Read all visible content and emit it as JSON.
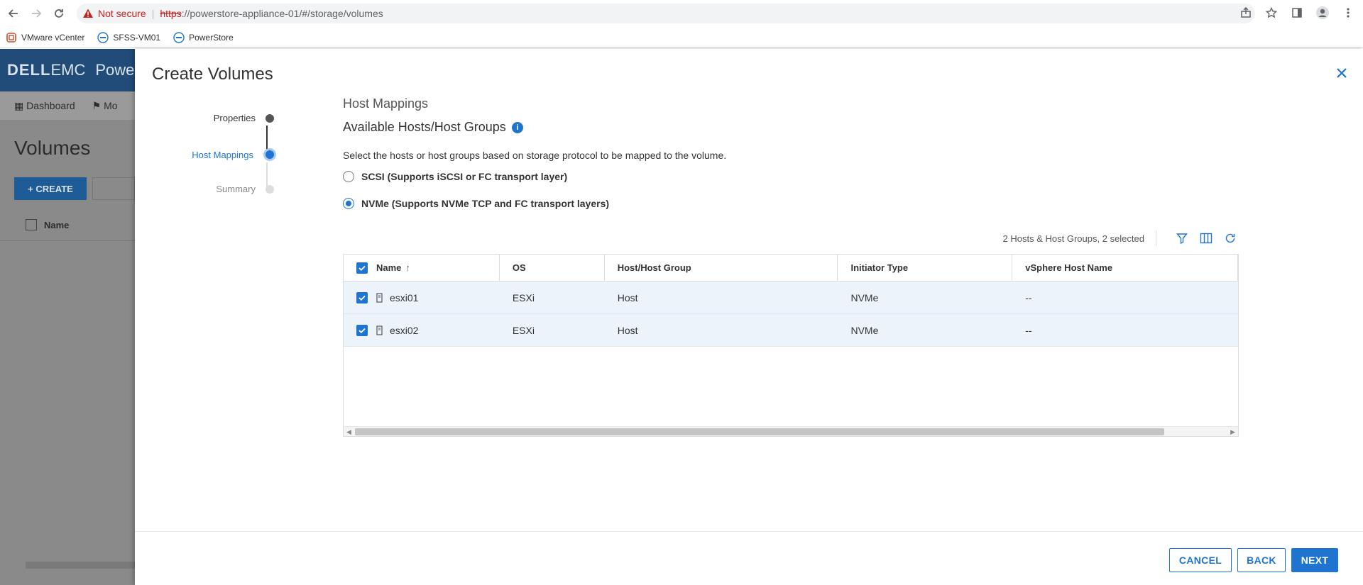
{
  "browser": {
    "security_label": "Not secure",
    "url_scheme": "https",
    "url_rest": "://powerstore-appliance-01/#/storage/volumes",
    "bookmarks": [
      "VMware vCenter",
      "SFSS-VM01",
      "PowerStore"
    ]
  },
  "background_app": {
    "brand_dell": "DELL",
    "brand_emc": "EMC",
    "product_partial": "Powe",
    "nav": [
      "Dashboard",
      "Mo"
    ],
    "page_title": "Volumes",
    "create_label": "+ CREATE",
    "column_name": "Name"
  },
  "modal": {
    "title": "Create Volumes",
    "steps": [
      "Properties",
      "Host Mappings",
      "Summary"
    ],
    "section_heading": "Host Mappings",
    "section_subheading": "Available Hosts/Host Groups",
    "info_icon_glyph": "i",
    "description": "Select the hosts or host groups based on storage protocol to be mapped to the volume.",
    "protocol_options": [
      {
        "label": "SCSI (Supports iSCSI or FC transport layer)",
        "selected": false
      },
      {
        "label": "NVMe (Supports NVMe TCP and FC transport layers)",
        "selected": true
      }
    ],
    "selection_summary": "2 Hosts & Host Groups, 2 selected",
    "table": {
      "columns": [
        "Name",
        "OS",
        "Host/Host Group",
        "Initiator Type",
        "vSphere Host Name"
      ],
      "rows": [
        {
          "name": "esxi01",
          "os": "ESXi",
          "host_group": "Host",
          "initiator_type": "NVMe",
          "vsphere_host_name": "--",
          "selected": true
        },
        {
          "name": "esxi02",
          "os": "ESXi",
          "host_group": "Host",
          "initiator_type": "NVMe",
          "vsphere_host_name": "--",
          "selected": true
        }
      ]
    },
    "buttons": {
      "cancel": "CANCEL",
      "back": "BACK",
      "next": "NEXT"
    }
  },
  "colors": {
    "accent": "#1e74d0",
    "header_bg": "#214b78",
    "warning": "#c5221f"
  }
}
